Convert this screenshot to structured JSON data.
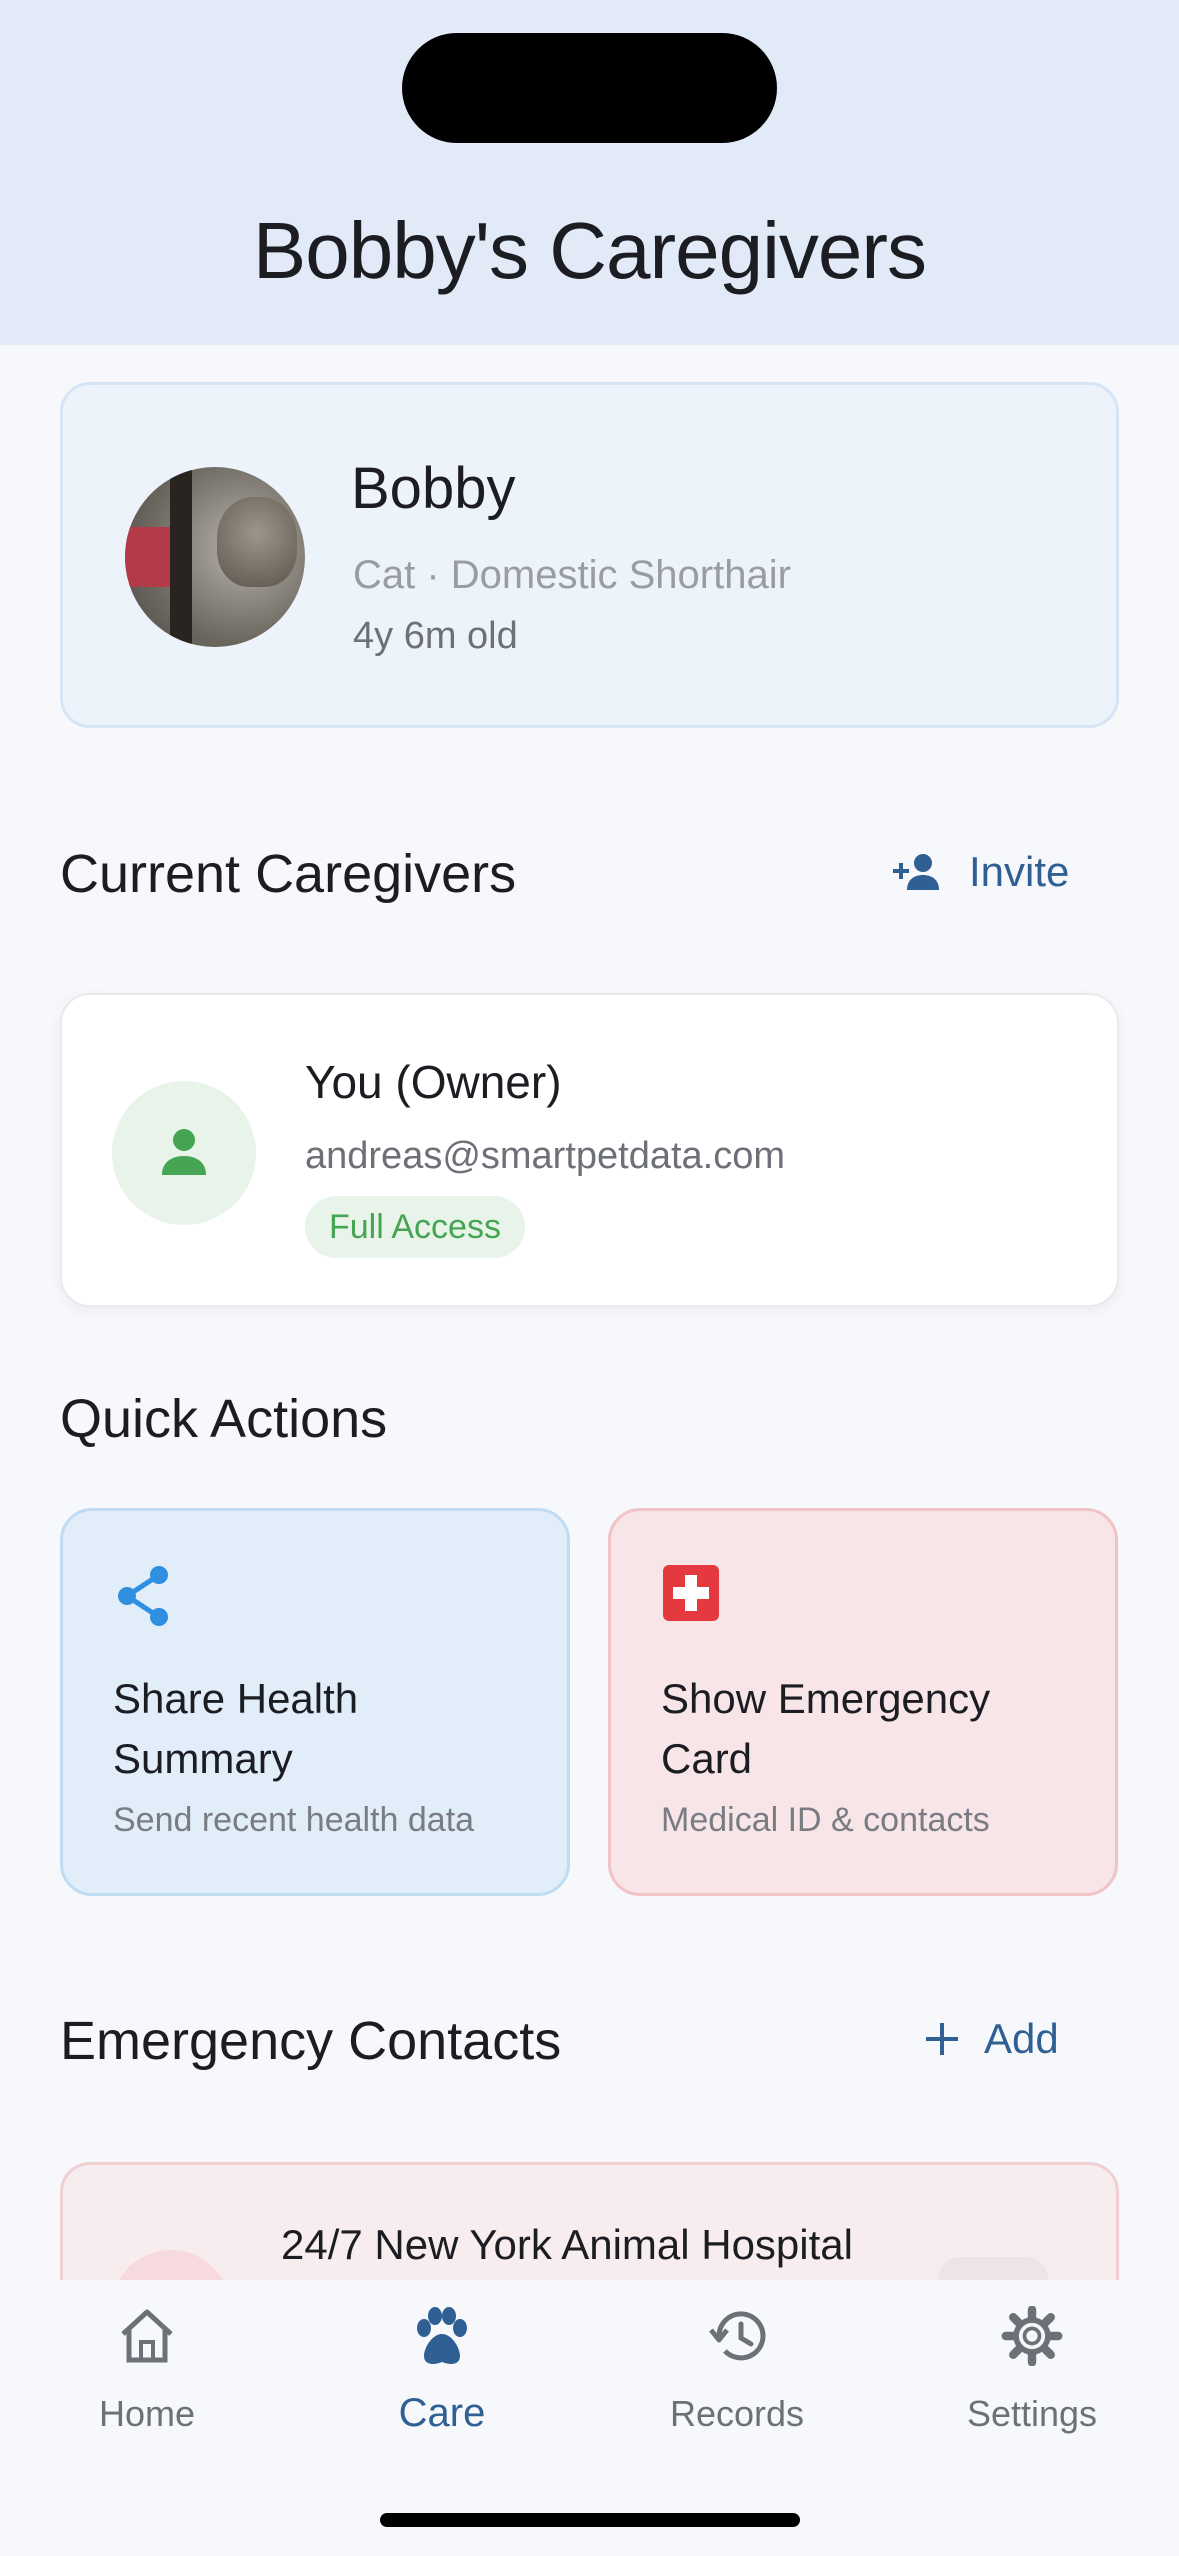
{
  "header": {
    "title": "Bobby's Caregivers"
  },
  "pet": {
    "name": "Bobby",
    "breed": "Cat · Domestic Shorthair",
    "age": "4y 6m old"
  },
  "caregivers": {
    "section_title": "Current Caregivers",
    "invite_label": "Invite",
    "items": [
      {
        "name": "You (Owner)",
        "email": "andreas@smartpetdata.com",
        "access": "Full Access"
      }
    ]
  },
  "quick_actions": {
    "section_title": "Quick Actions",
    "items": [
      {
        "title": "Share Health Summary",
        "subtitle": "Send recent health data",
        "icon": "share-icon"
      },
      {
        "title": "Show Emergency Card",
        "subtitle": "Medical ID & contacts",
        "icon": "medical-cross-icon"
      }
    ]
  },
  "emergency_contacts": {
    "section_title": "Emergency Contacts",
    "add_label": "Add",
    "items": [
      {
        "name": "24/7 New York Animal Hospital"
      }
    ]
  },
  "nav": {
    "active": "Care",
    "items": [
      {
        "label": "Home",
        "icon": "home-icon"
      },
      {
        "label": "Care",
        "icon": "paw-icon"
      },
      {
        "label": "Records",
        "icon": "history-icon"
      },
      {
        "label": "Settings",
        "icon": "gear-icon"
      }
    ]
  },
  "colors": {
    "header_bg": "#e1eaf6",
    "accent_blue": "#2f5f93",
    "success_green": "#45a553",
    "emergency_red": "#e53940",
    "share_blue": "#2f8fe0"
  }
}
